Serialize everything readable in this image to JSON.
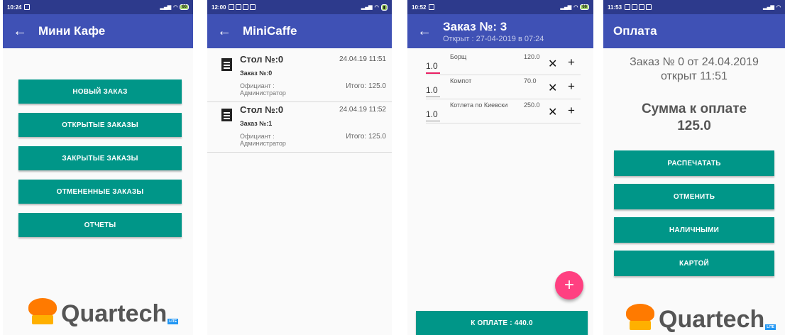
{
  "screen1": {
    "status_time": "10:24",
    "battery": "66",
    "title": "Мини Кафе",
    "buttons": [
      "НОВЫЙ ЗАКАЗ",
      "ОТКРЫТЫЕ ЗАКАЗЫ",
      "ЗАКРЫТЫЕ ЗАКАЗЫ",
      "ОТМЕНЕННЫЕ ЗАКАЗЫ",
      "ОТЧЕТЫ"
    ],
    "logo_text": "Quartech",
    "logo_badge": "LITE"
  },
  "screen2": {
    "status_time": "12:00",
    "title": "MiniCaffe",
    "orders": [
      {
        "table": "Стол №:0",
        "datetime": "24.04.19 11:51",
        "order_no": "Заказ №:0",
        "waiter": "Официант : Администратор",
        "total": "Итого: 125.0"
      },
      {
        "table": "Стол №:0",
        "datetime": "24.04.19 11:52",
        "order_no": "Заказ №:1",
        "waiter": "Официант : Администратор",
        "total": "Итого: 125.0"
      }
    ]
  },
  "screen3": {
    "status_time": "10:52",
    "battery": "66",
    "title": "Заказ №: 3",
    "subtitle": "Открыт : 27-04-2019 в 07:24",
    "items": [
      {
        "qty": "1.0",
        "name": "Борщ",
        "price": "120.0"
      },
      {
        "qty": "1.0",
        "name": "Компот",
        "price": "70.0"
      },
      {
        "qty": "1.0",
        "name": "Котлета по Киевски",
        "price": "250.0"
      }
    ],
    "fab_icon": "plus-icon",
    "pay_button": "К ОПЛАТЕ : 440.0"
  },
  "screen4": {
    "status_time": "11:53",
    "title": "Оплата",
    "order_line1": "Заказ № 0 от 24.04.2019",
    "order_line2": "открыт 11:51",
    "sum_label": "Сумма к оплате",
    "sum_value": "125.0",
    "buttons": [
      "РАСПЕЧАТАТЬ",
      "ОТМЕНИТЬ",
      "НАЛИЧНЫМИ",
      "КАРТОЙ"
    ],
    "logo_text": "Quartech",
    "logo_badge": "LITE"
  },
  "colors": {
    "statusbar": "#2d3a8c",
    "appbar": "#3f51b5",
    "button": "#009688",
    "fab": "#ff4081",
    "logo_orange": "#ff7a00"
  }
}
